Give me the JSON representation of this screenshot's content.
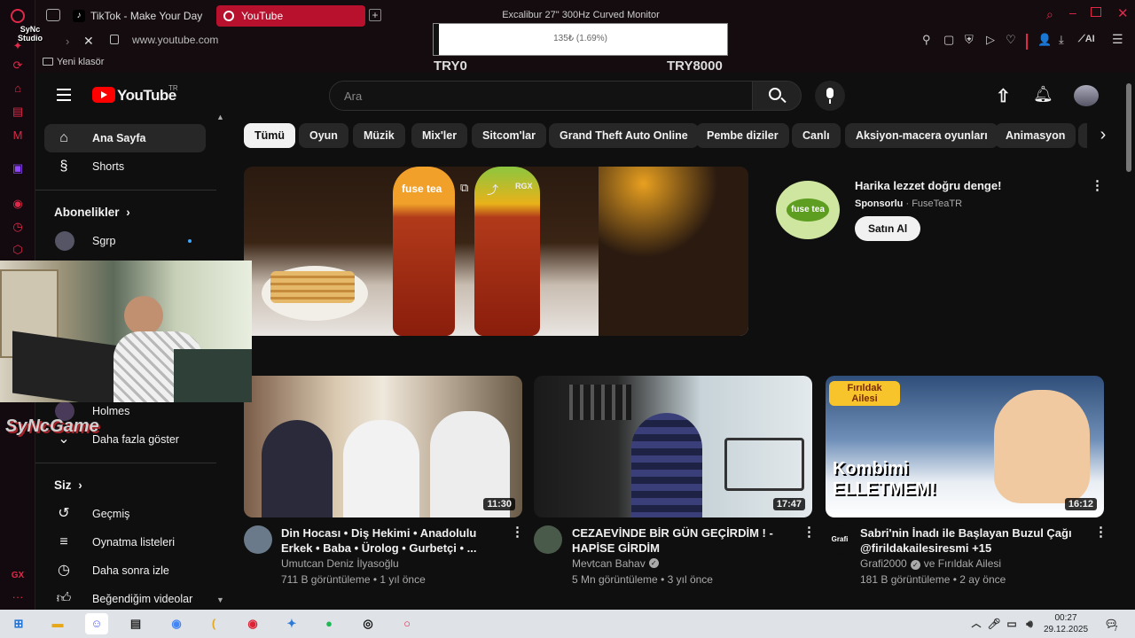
{
  "browser": {
    "tabs": [
      {
        "label": "TikTok - Make Your Day",
        "icon": "tiktok-icon"
      },
      {
        "label": "YouTube",
        "icon": "youtube-icon"
      }
    ],
    "window_title": "Excalibur 27\" 300Hz Curved Monitor",
    "url": "www.youtube.com",
    "bookmark_folder": "Yeni klasör",
    "gx_label": "GX",
    "accent": "#e0284a"
  },
  "overlay": {
    "donation_bar": {
      "text": "135₺ (1.69%)",
      "min": "TRY0",
      "max": "TRY8000",
      "progress": 0.0169
    },
    "streamer_logo": "SyNcGame",
    "stream_badge": "SyNc Studio"
  },
  "youtube": {
    "logo": "YouTube",
    "logo_region": "TR",
    "search_placeholder": "Ara",
    "chips": [
      "Tümü",
      "Oyun",
      "Müzik",
      "Mix'ler",
      "Sitcom'lar",
      "Grand Theft Auto Online",
      "Pembe diziler",
      "Canlı",
      "Aksiyon-macera oyunları",
      "Animasyon"
    ],
    "sidebar": {
      "main": [
        {
          "label": "Ana Sayfa",
          "icon": "home-icon"
        },
        {
          "label": "Shorts",
          "icon": "shorts-icon"
        }
      ],
      "subscriptions_header": "Abonelikler",
      "subscriptions": [
        {
          "label": "Sgrp"
        },
        {
          "label": "Holmes"
        }
      ],
      "show_more": "Daha fazla göster",
      "you_header": "Siz",
      "you": [
        {
          "label": "Geçmiş",
          "icon": "history-icon"
        },
        {
          "label": "Oynatma listeleri",
          "icon": "playlist-icon"
        },
        {
          "label": "Daha sonra izle",
          "icon": "watch-later-icon"
        },
        {
          "label": "Beğendiğim videolar",
          "icon": "like-icon"
        }
      ]
    },
    "ad": {
      "title": "Harika lezzet doğru denge!",
      "sponsored": "Sponsorlu",
      "advertiser": "FuseTeaTR",
      "cta": "Satın Al",
      "brand_text": "fuse tea",
      "thumb_badge": "RGX"
    },
    "videos": [
      {
        "title": "Din Hocası • Diş Hekimi • Anadolulu Erkek • Baba • Ürolog • Gurbetçi • ...",
        "channel": "Umutcan Deniz İlyasoğlu",
        "verified": false,
        "views": "711 B görüntüleme",
        "age": "1 yıl önce",
        "duration": "11:30"
      },
      {
        "title": "CEZAEVİNDE BİR GÜN GEÇİRDİM ! - HAPİSE GİRDİM",
        "channel": "Mevtcan Bahav",
        "verified": true,
        "views": "5 Mn görüntüleme",
        "age": "3 yıl önce",
        "duration": "17:47"
      },
      {
        "title": "Sabri'nin İnadı ile Başlayan Buzul Çağı @firildakailesiresmi +15",
        "channel": "Grafi2000",
        "channel_suffix": "ve Fırıldak Ailesi",
        "verified": true,
        "views": "181 B görüntüleme",
        "age": "2 ay önce",
        "duration": "16:12",
        "thumb_text_top": "Fırıldak Ailesi",
        "thumb_text_main": "Kombimi ELLETMEM!"
      }
    ],
    "meta_separator": " • "
  },
  "taskbar": {
    "time": "00:27",
    "date": "29.12.2025",
    "notifications": "7"
  }
}
